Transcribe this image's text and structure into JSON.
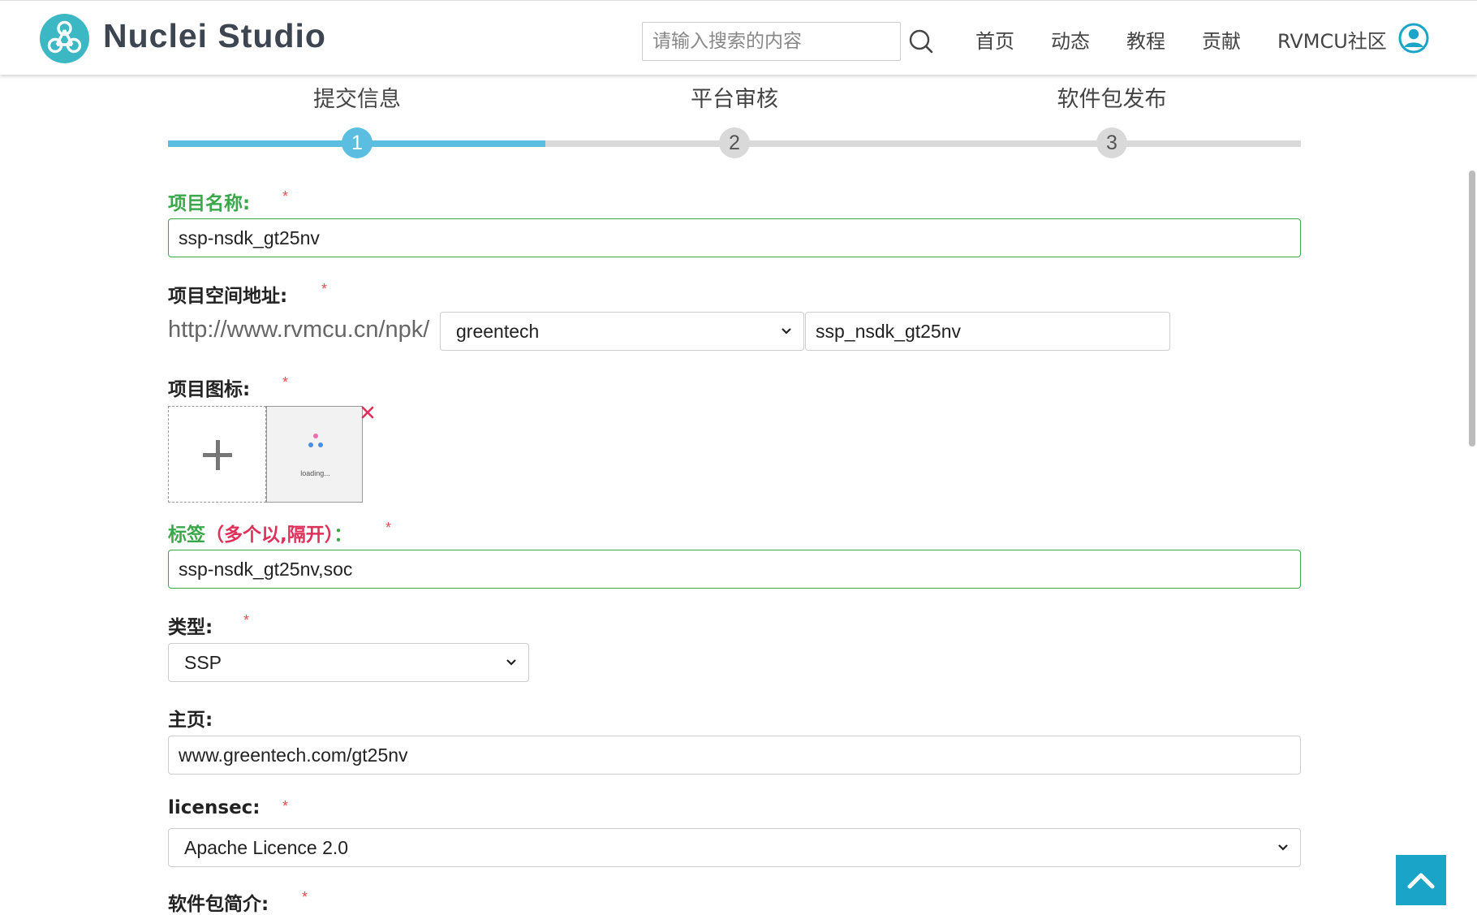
{
  "header": {
    "logo_text": "Nuclei Studio",
    "search_placeholder": "请输入搜索的内容",
    "nav": [
      "首页",
      "动态",
      "教程",
      "贡献",
      "RVMCU社区"
    ]
  },
  "steps": {
    "current": 1,
    "items": [
      {
        "label": "提交信息",
        "number": "1"
      },
      {
        "label": "平台审核",
        "number": "2"
      },
      {
        "label": "软件包发布",
        "number": "3"
      }
    ]
  },
  "form": {
    "required_mark": "*",
    "name": {
      "label": "项目名称:",
      "value": "ssp-nsdk_gt25nv"
    },
    "space": {
      "label": "项目空间地址:",
      "prefix": "http://www.rvmcu.cn/npk/",
      "owner": "greentech",
      "slug": "ssp_nsdk_gt25nv"
    },
    "icon": {
      "label": "项目图标:",
      "loading_text": "loading..."
    },
    "tags": {
      "label": "标签",
      "hint": "（多个以,隔开）",
      "colon": "：",
      "value": "ssp-nsdk_gt25nv,soc"
    },
    "type": {
      "label": "类型:",
      "value": "SSP"
    },
    "homepage": {
      "label": "主页:",
      "value": "www.greentech.com/gt25nv"
    },
    "license": {
      "label": "licensec:",
      "value": "Apache Licence 2.0"
    },
    "intro": {
      "label": "软件包简介:"
    }
  },
  "colors": {
    "accent": "#5bbde0",
    "valid": "#3aa84a",
    "error": "#e0305a",
    "logo": "#3bb8c3",
    "back_to_top": "#1aa4c8"
  },
  "icons": {
    "search": "search-icon",
    "user": "user-avatar-icon",
    "remove": "close-icon",
    "back_to_top": "chevron-up-icon",
    "dropdown": "chevron-down-icon"
  }
}
